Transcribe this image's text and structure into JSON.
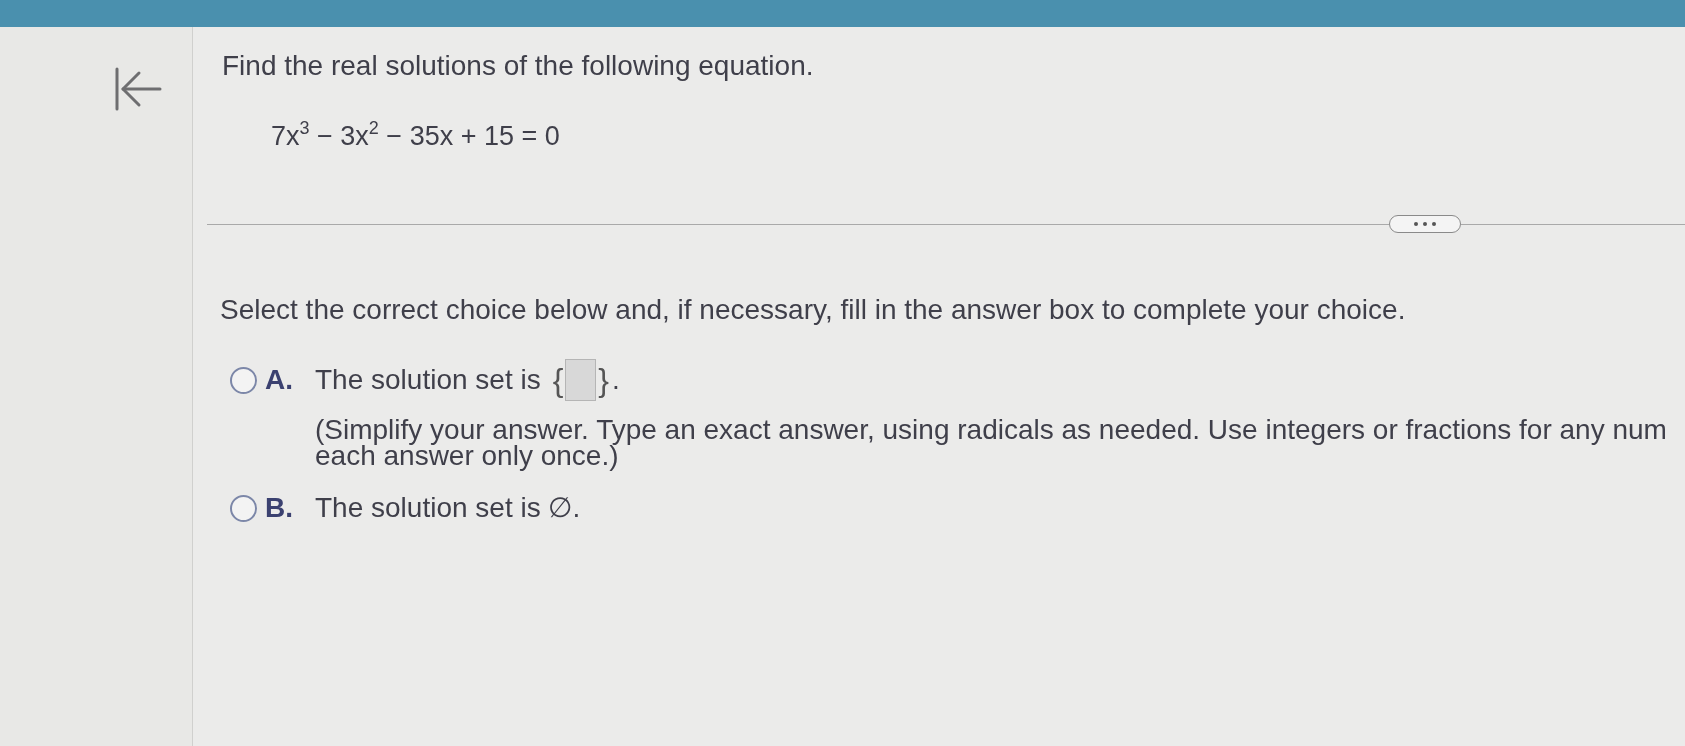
{
  "question": {
    "prompt": "Find the real solutions of the following equation.",
    "equation": "7x$^{3}$ − 3x$^{2}$ − 35x + 15 = 0"
  },
  "instruction": "Select the correct choice below and, if necessary, fill in the answer box to complete your choice.",
  "choices": [
    {
      "kind": "answer_set",
      "letter": "A.",
      "text": "The solution set is",
      "brace_open": "{",
      "brace_close": "}",
      "after": ".",
      "hint_lines": [
        "(Simplify your answer. Type an exact answer, using radicals as needed. Use integers or fractions for any num",
        "each answer only once.)"
      ],
      "selected": false
    },
    {
      "kind": "plain",
      "letter": "B.",
      "text": "The solution set is ∅.",
      "selected": false
    }
  ]
}
